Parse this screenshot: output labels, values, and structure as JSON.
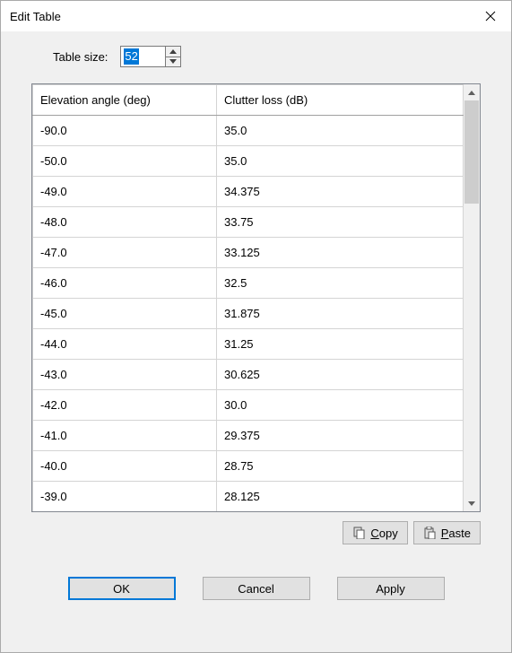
{
  "window": {
    "title": "Edit Table"
  },
  "tableSize": {
    "label": "Table size:",
    "value": "52"
  },
  "columns": [
    "Elevation angle (deg)",
    "Clutter loss (dB)"
  ],
  "rows": [
    {
      "elev": "-90.0",
      "loss": "35.0"
    },
    {
      "elev": "-50.0",
      "loss": "35.0"
    },
    {
      "elev": "-49.0",
      "loss": "34.375"
    },
    {
      "elev": "-48.0",
      "loss": "33.75"
    },
    {
      "elev": "-47.0",
      "loss": "33.125"
    },
    {
      "elev": "-46.0",
      "loss": "32.5"
    },
    {
      "elev": "-45.0",
      "loss": "31.875"
    },
    {
      "elev": "-44.0",
      "loss": "31.25"
    },
    {
      "elev": "-43.0",
      "loss": "30.625"
    },
    {
      "elev": "-42.0",
      "loss": "30.0"
    },
    {
      "elev": "-41.0",
      "loss": "29.375"
    },
    {
      "elev": "-40.0",
      "loss": "28.75"
    },
    {
      "elev": "-39.0",
      "loss": "28.125"
    }
  ],
  "buttons": {
    "copy": "Copy",
    "paste": "Paste",
    "ok": "OK",
    "cancel": "Cancel",
    "apply": "Apply"
  }
}
